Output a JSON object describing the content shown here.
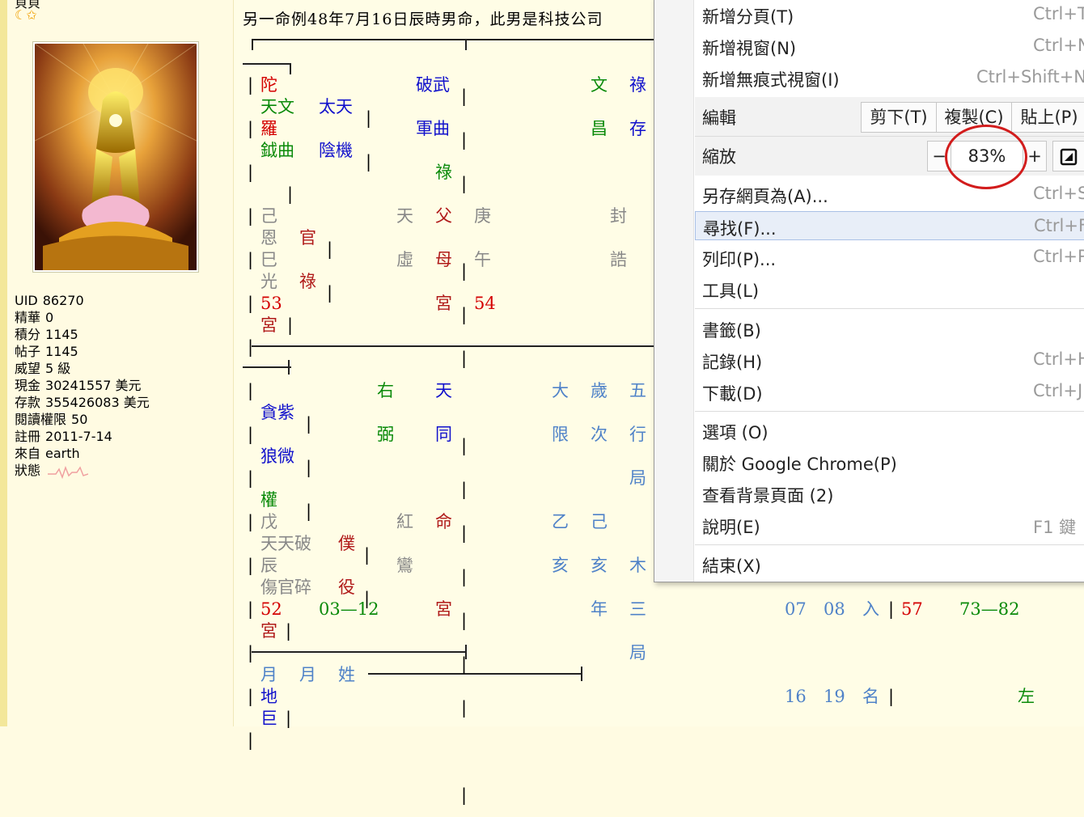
{
  "profile": {
    "name_fragment": "貝貝",
    "avatar_alt": "avatar",
    "stats": [
      {
        "label": "UID",
        "value": "86270"
      },
      {
        "label": "精華",
        "value": "0"
      },
      {
        "label": "積分",
        "value": "1145"
      },
      {
        "label": "帖子",
        "value": "1145"
      },
      {
        "label": "威望",
        "value": "5 級"
      },
      {
        "label": "現金",
        "value": "30241557 美元"
      },
      {
        "label": "存款",
        "value": "355426083 美元"
      },
      {
        "label": "閱讀權限",
        "value": "50"
      },
      {
        "label": "註冊",
        "value": "2011-7-14"
      },
      {
        "label": "來自",
        "value": "earth"
      },
      {
        "label": "狀態",
        "value": ""
      }
    ]
  },
  "post": {
    "intro": "另一命例48年7月16日辰時男命，此男是科技公司",
    "chart": {
      "c1": [
        "陀",
        "破武",
        "羅",
        "軍曲",
        "祿",
        "己",
        "天",
        "父",
        "恩",
        "官",
        "巳",
        "虛",
        "母",
        "光",
        "祿",
        "53",
        "宮",
        "宮"
      ],
      "c2": [
        "文",
        "祿",
        "天文",
        "太天",
        "昌",
        "存",
        "鉞曲",
        "陰機",
        "庚",
        "封",
        "午",
        "誥",
        "54"
      ],
      "row2": [
        "右",
        "天",
        "大",
        "歲",
        "五",
        "貪紫",
        "弼",
        "同",
        "限",
        "次",
        "行",
        "狼微",
        "局",
        "權",
        "戊",
        "紅",
        "命",
        "乙",
        "己",
        "天天破",
        "僕",
        "辰",
        "鸞",
        "亥",
        "亥",
        "木",
        "傷官碎",
        "役",
        "52",
        "03—12",
        "宮",
        "年",
        "三",
        "宮",
        "局"
      ],
      "row3": [
        "月",
        "月",
        "姓",
        "地",
        "巨",
        "07",
        "08",
        "入",
        "57",
        "73—82",
        "16",
        "19",
        "名",
        "左"
      ]
    }
  },
  "menu": {
    "items": [
      {
        "label": "新增分頁(T)",
        "shortcut": "Ctrl+T"
      },
      {
        "label": "新增視窗(N)",
        "shortcut": "Ctrl+N"
      },
      {
        "label": "新增無痕式視窗(I)",
        "shortcut": "Ctrl+Shift+N"
      }
    ],
    "edit": {
      "label": "編輯",
      "cut": "剪下(T)",
      "copy": "複製(C)",
      "paste": "貼上(P)"
    },
    "zoom": {
      "label": "縮放",
      "minus": "−",
      "value": "83%",
      "plus": "+"
    },
    "items2": [
      {
        "label": "另存網頁為(A)...",
        "shortcut": "Ctrl+S"
      },
      {
        "label": "尋找(F)...",
        "shortcut": "Ctrl+F"
      },
      {
        "label": "列印(P)...",
        "shortcut": "Ctrl+P"
      },
      {
        "label": "工具(L)",
        "shortcut": ""
      }
    ],
    "items3": [
      {
        "label": "書籤(B)",
        "shortcut": ""
      },
      {
        "label": "記錄(H)",
        "shortcut": "Ctrl+H"
      },
      {
        "label": "下載(D)",
        "shortcut": "Ctrl+J"
      }
    ],
    "items4": [
      {
        "label": "選項 (O)",
        "shortcut": ""
      },
      {
        "label": "關於 Google Chrome(P)",
        "shortcut": ""
      },
      {
        "label": "查看背景頁面 (2)",
        "shortcut": ""
      },
      {
        "label": "說明(E)",
        "shortcut": "F1 鍵"
      }
    ],
    "exit": {
      "label": "結束(X)"
    }
  }
}
